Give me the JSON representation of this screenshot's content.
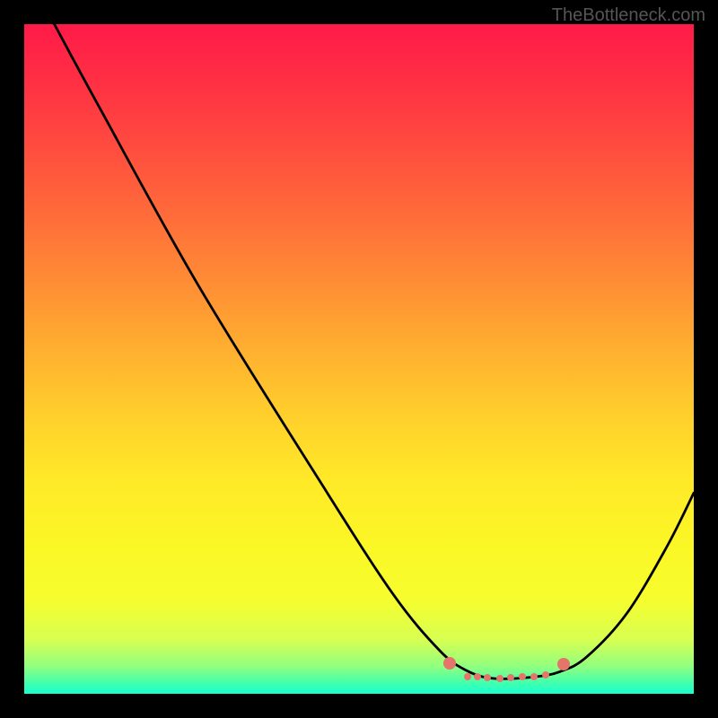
{
  "watermark": "TheBottleneck.com",
  "chart_data": {
    "type": "line",
    "title": "",
    "xlabel": "",
    "ylabel": "",
    "xlim": [
      0,
      100
    ],
    "ylim": [
      0,
      100
    ],
    "grid": false,
    "series": [
      {
        "name": "curve",
        "color": "#000000",
        "points": [
          {
            "x": 4.5,
            "y": 100
          },
          {
            "x": 11,
            "y": 88
          },
          {
            "x": 26,
            "y": 61
          },
          {
            "x": 44,
            "y": 32
          },
          {
            "x": 55,
            "y": 15
          },
          {
            "x": 62,
            "y": 6.5
          },
          {
            "x": 66,
            "y": 3.5
          },
          {
            "x": 70,
            "y": 2.3
          },
          {
            "x": 76,
            "y": 2.5
          },
          {
            "x": 80,
            "y": 3.3
          },
          {
            "x": 84,
            "y": 5.5
          },
          {
            "x": 90,
            "y": 12
          },
          {
            "x": 96,
            "y": 22
          },
          {
            "x": 100,
            "y": 30
          }
        ]
      }
    ],
    "markers": {
      "color": "#e5756b",
      "points": [
        {
          "x": 63.5,
          "y": 4.6,
          "size": "big"
        },
        {
          "x": 66.2,
          "y": 2.6,
          "size": "small"
        },
        {
          "x": 67.7,
          "y": 2.5,
          "size": "small"
        },
        {
          "x": 69.2,
          "y": 2.4,
          "size": "small"
        },
        {
          "x": 71.0,
          "y": 2.3,
          "size": "small"
        },
        {
          "x": 72.7,
          "y": 2.4,
          "size": "small"
        },
        {
          "x": 74.4,
          "y": 2.5,
          "size": "small"
        },
        {
          "x": 76.2,
          "y": 2.6,
          "size": "small"
        },
        {
          "x": 77.9,
          "y": 2.8,
          "size": "small"
        },
        {
          "x": 80.6,
          "y": 4.4,
          "size": "big"
        }
      ]
    },
    "background_gradient": {
      "top_color": "#ff1a49",
      "bottom_color": "#18ffd0"
    }
  }
}
